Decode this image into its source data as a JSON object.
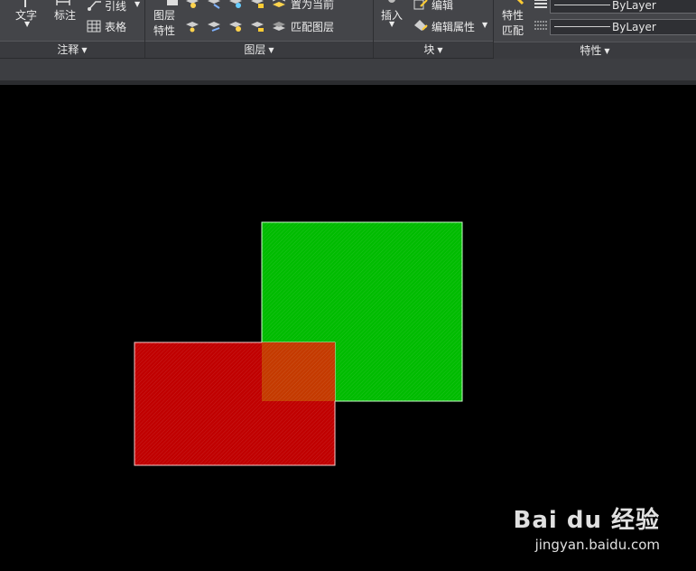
{
  "ribbon": {
    "annotate": {
      "text_label": "文字",
      "dimension_label": "标注",
      "leader_label": "引线",
      "table_label": "表格",
      "footer": "注释"
    },
    "layers": {
      "layer_props_line1": "图层",
      "layer_props_line2": "特性",
      "set_current_label": "置为当前",
      "match_layer_label": "匹配图层",
      "footer": "图层"
    },
    "block": {
      "insert_label": "插入",
      "edit_label": "编辑",
      "edit_attr_label": "编辑属性",
      "footer": "块"
    },
    "properties": {
      "match_line1": "特性",
      "match_line2": "匹配",
      "lineweight_value": "ByLayer",
      "linetype_value": "ByLayer",
      "footer": "特性"
    }
  },
  "canvas": {
    "shapes": [
      {
        "name": "green-rectangle",
        "fill": "#00bb00",
        "stroke": "#c8ffc8"
      },
      {
        "name": "red-rectangle",
        "fill": "#c00000",
        "stroke": "#ffc8c8"
      },
      {
        "name": "overlap-region",
        "fill": "#c43a00"
      }
    ]
  },
  "watermark": {
    "brand": "Bai du 经验",
    "url": "jingyan.baidu.com"
  },
  "colors": {
    "ribbon_bg": "#444549",
    "canvas_bg": "#000000",
    "green": "#00bb00",
    "red": "#c00000",
    "overlap": "#c43a00"
  }
}
